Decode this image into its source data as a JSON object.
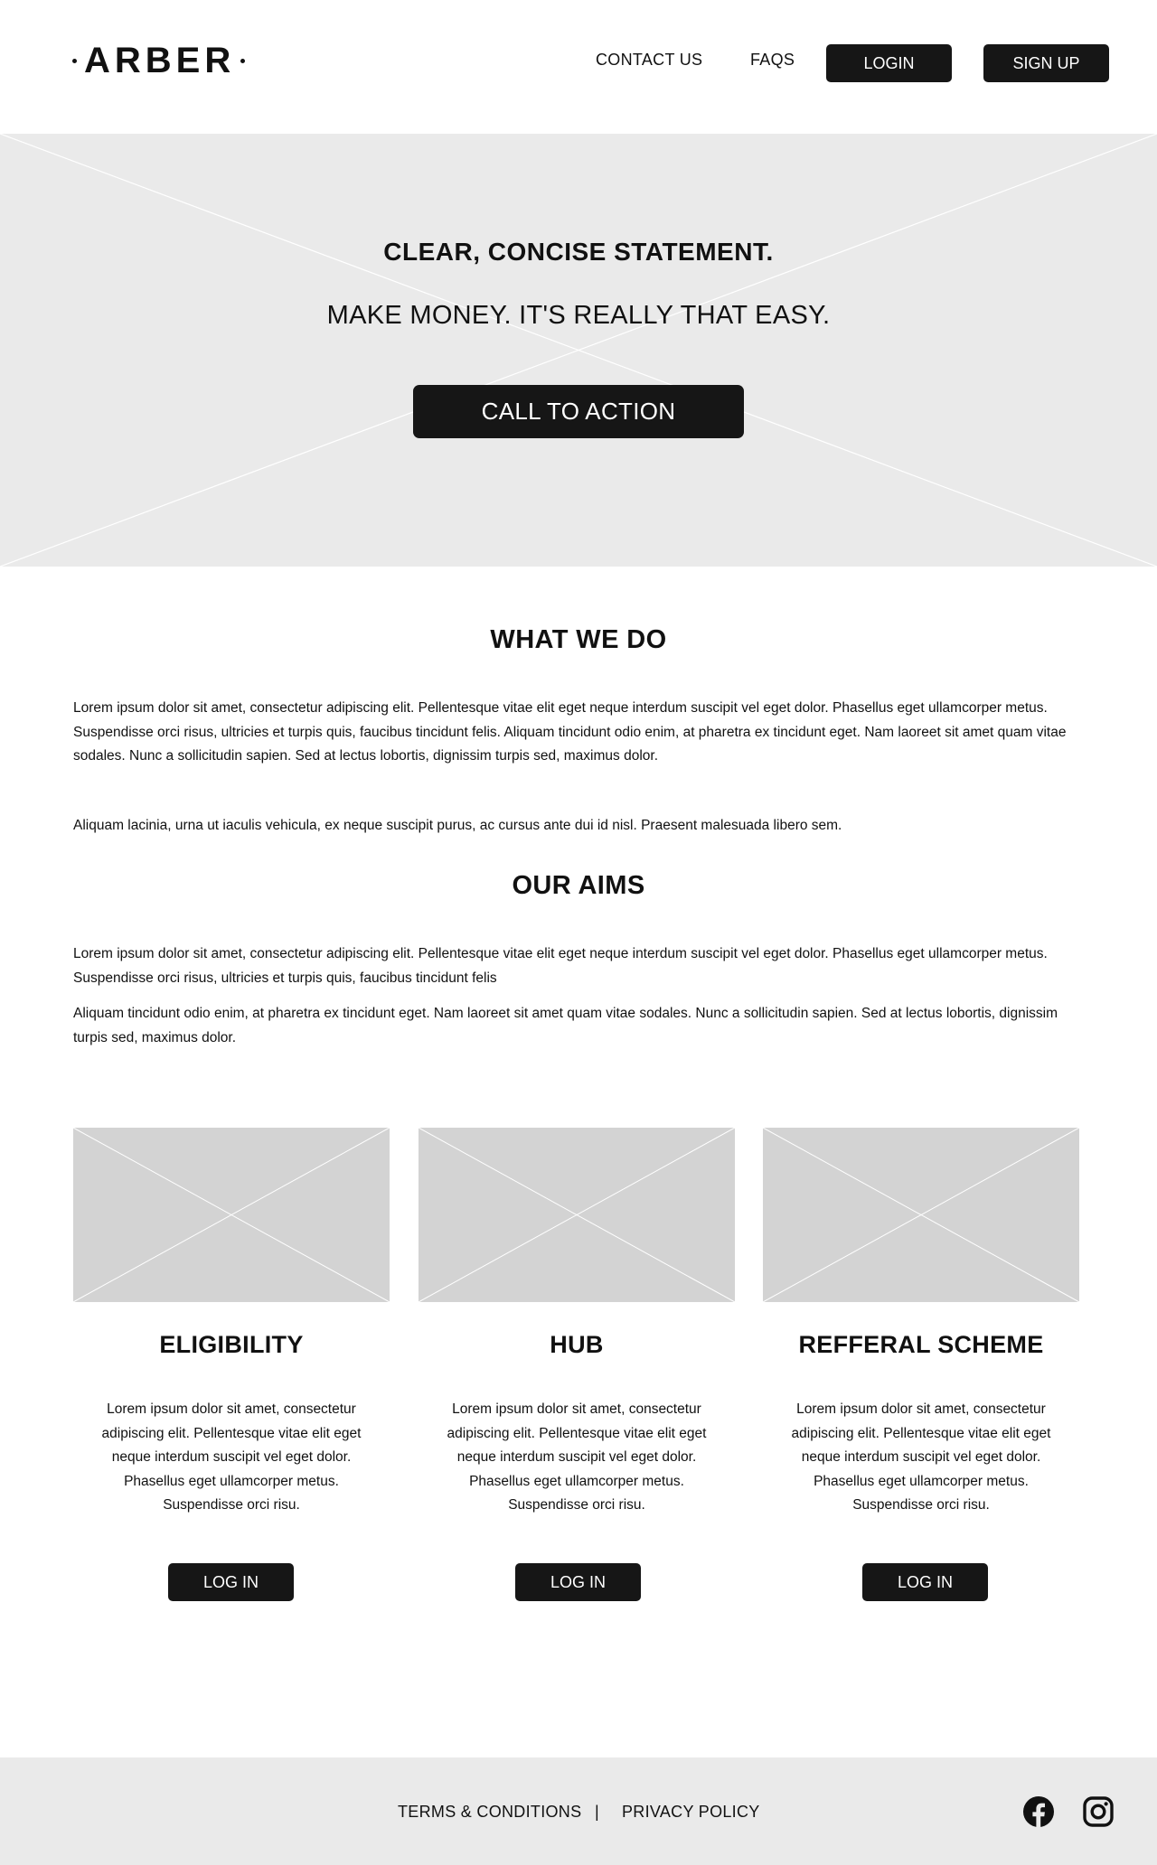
{
  "header": {
    "logo_text": "ARBER",
    "nav": {
      "contact_label": "CONTACT US",
      "faqs_label": "FAQS",
      "login_label": "LOGIN",
      "signup_label": "SIGN UP"
    }
  },
  "hero": {
    "title": "CLEAR, CONCISE STATEMENT.",
    "subtitle": "MAKE MONEY. IT'S REALLY THAT EASY.",
    "cta_label": "CALL TO ACTION"
  },
  "what_we_do": {
    "title": "WHAT WE DO",
    "paragraphs": [
      "Lorem ipsum dolor sit amet, consectetur adipiscing elit. Pellentesque vitae elit eget neque interdum suscipit vel eget dolor. Phasellus eget ullamcorper metus. Suspendisse orci risus, ultricies et turpis quis, faucibus tincidunt felis. Aliquam tincidunt odio enim, at pharetra ex tincidunt eget. Nam laoreet sit amet quam vitae sodales. Nunc a sollicitudin sapien. Sed at lectus lobortis, dignissim turpis sed, maximus dolor.",
      "Aliquam lacinia, urna ut iaculis vehicula, ex neque suscipit purus, ac cursus ante dui id nisl. Praesent malesuada libero sem."
    ]
  },
  "our_aims": {
    "title": "OUR AIMS",
    "paragraphs": [
      "Lorem ipsum dolor sit amet, consectetur adipiscing elit. Pellentesque vitae elit eget neque interdum suscipit vel eget dolor. Phasellus eget ullamcorper metus. Suspendisse orci risus, ultricies et turpis quis, faucibus tincidunt felis",
      "Aliquam tincidunt odio enim, at pharetra ex tincidunt eget. Nam laoreet sit amet quam vitae sodales. Nunc a sollicitudin sapien. Sed at lectus lobortis, dignissim turpis sed, maximus dolor."
    ]
  },
  "cards": [
    {
      "title": "ELIGIBILITY",
      "text": "Lorem ipsum dolor sit amet, consectetur adipiscing elit. Pellentesque vitae elit eget neque interdum suscipit vel eget dolor. Phasellus eget ullamcorper metus. Suspendisse orci risu.",
      "button_label": "LOG IN"
    },
    {
      "title": "HUB",
      "text": "Lorem ipsum dolor sit amet, consectetur adipiscing elit. Pellentesque vitae elit eget neque interdum suscipit vel eget dolor. Phasellus eget ullamcorper metus. Suspendisse orci risu.",
      "button_label": "LOG IN"
    },
    {
      "title": "REFFERAL SCHEME",
      "text": "Lorem ipsum dolor sit amet, consectetur adipiscing elit. Pellentesque vitae elit eget neque interdum suscipit vel eget dolor. Phasellus eget ullamcorper metus. Suspendisse orci risu.",
      "button_label": "LOG IN"
    }
  ],
  "footer": {
    "terms_label": "TERMS & CONDITIONS",
    "separator": "|",
    "privacy_label": "PRIVACY POLICY",
    "social_icons": [
      "facebook-icon",
      "instagram-icon"
    ]
  },
  "colors": {
    "dark_button": "#161616",
    "hero_bg": "#eaeaea",
    "placeholder_bg": "#d3d3d3",
    "footer_bg": "#eaeaea"
  }
}
